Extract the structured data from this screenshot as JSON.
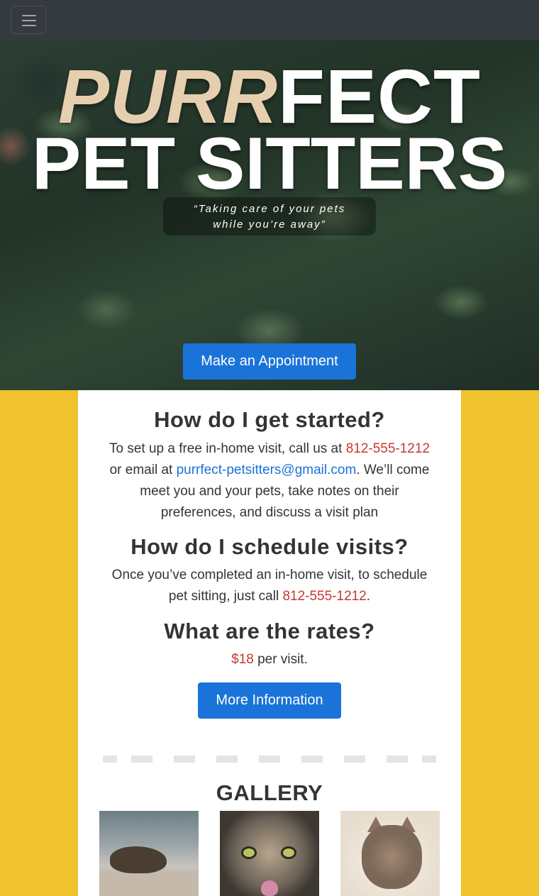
{
  "navbar": {
    "toggle_icon": "hamburger-menu-icon"
  },
  "hero": {
    "title_purr": "PURR",
    "title_fect": "FECT",
    "title_line2": "PET SITTERS",
    "tagline_line1": "“Taking care of your pets",
    "tagline_line2": "while you’re away”",
    "appointment_button": "Make an Appointment"
  },
  "faq": {
    "started": {
      "heading": "How do I get started?",
      "text_1": "To set up a free in-home visit, call us at ",
      "phone": "812-555-1212",
      "text_2": " or email at ",
      "email": "purrfect-petsitters@gmail.com",
      "text_3": ". We’ll come meet you and your pets, take notes on their preferences, and discuss a visit plan"
    },
    "schedule": {
      "heading": "How do I schedule visits?",
      "text_1": "Once you’ve completed an in-home visit, to schedule pet sitting, just call ",
      "phone": "812-555-1212",
      "text_2": "."
    },
    "rates": {
      "heading": "What are the rates?",
      "price": "$18",
      "text": " per visit."
    },
    "more_button": "More Information"
  },
  "gallery": {
    "heading": "GALLERY",
    "images": [
      "cat-lying-on-bench",
      "tabby-cat-closeup",
      "fluffy-kitten"
    ]
  },
  "colors": {
    "navbar": "#343a40",
    "accent_blue": "#1a73d9",
    "phone_red": "#c43a2c",
    "background_yellow": "#f0c22d",
    "purr_tan": "#e6cfaf"
  }
}
